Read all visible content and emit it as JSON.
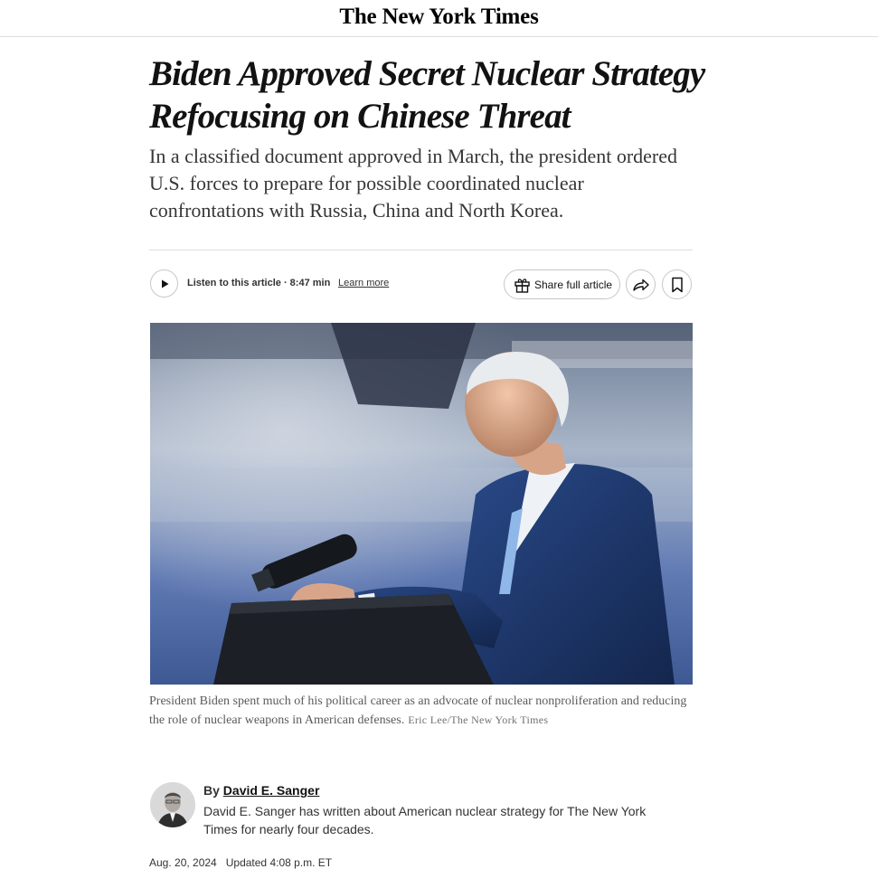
{
  "masthead": {
    "logo": "The New York Times"
  },
  "article": {
    "headline": "Biden Approved Secret Nuclear Strategy Refocusing on Chinese Threat",
    "summary": "In a classified document approved in March, the president ordered U.S. forces to prepare for possible coordinated nuclear confrontations with Russia, China and North Korea.",
    "caption": "President Biden spent much of his political career as an advocate of nuclear nonproliferation and reducing the role of nuclear weapons in American defenses.",
    "credit": "Eric Lee/The New York Times",
    "byline": {
      "prefix": "By",
      "author": "David E. Sanger",
      "bio": "David E. Sanger has written about American nuclear strategy for The New York Times for nearly four decades."
    },
    "date": "Aug. 20, 2024",
    "updated": "Updated 4:08 p.m. ET"
  },
  "toolbar": {
    "listen_label": "Listen to this article · 8:47 min",
    "learn_more": "Learn more",
    "share_full": "Share full article"
  },
  "icons": {
    "play": "play-icon",
    "gift": "gift-icon",
    "share": "share-arrow-icon",
    "bookmark": "bookmark-icon"
  }
}
